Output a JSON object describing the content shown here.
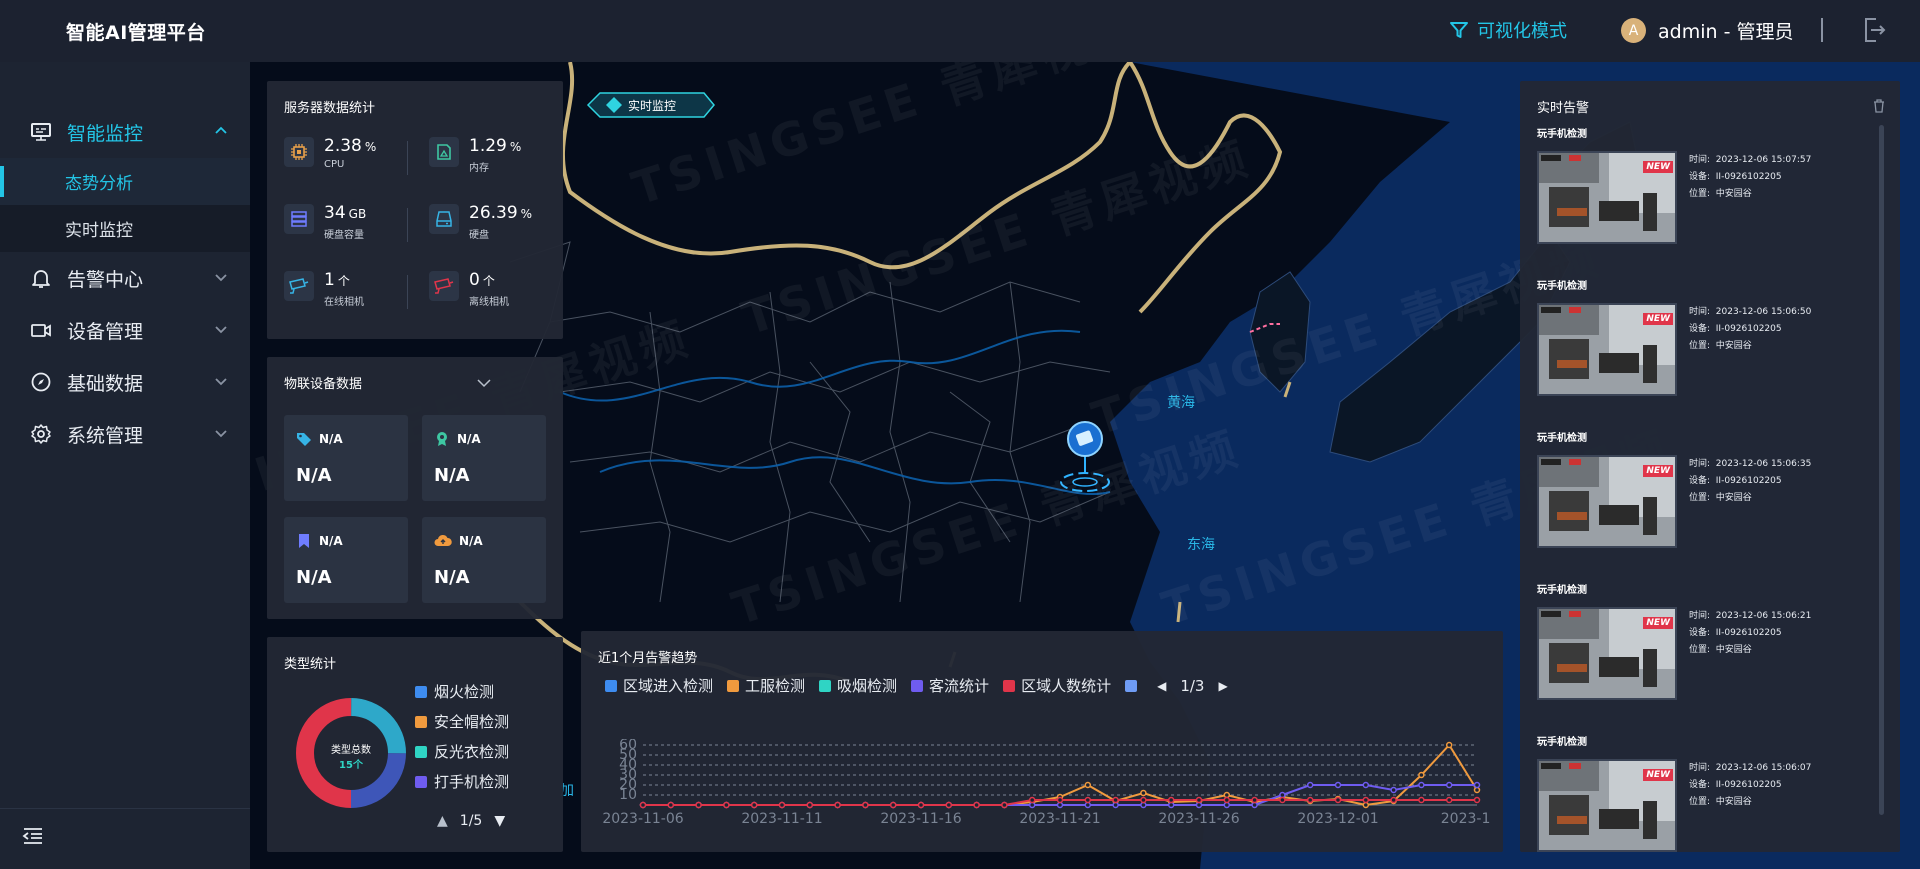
{
  "header": {
    "title": "智能AI管理平台",
    "mode_label": "可视化模式",
    "avatar_letter": "A",
    "user_label": "admin - 管理员"
  },
  "sidebar": {
    "items": [
      {
        "label": "智能监控",
        "icon": "monitor-icon",
        "expanded": true
      },
      {
        "label": "告警中心",
        "icon": "bell-icon"
      },
      {
        "label": "设备管理",
        "icon": "camera-device-icon"
      },
      {
        "label": "基础数据",
        "icon": "compass-icon"
      },
      {
        "label": "系统管理",
        "icon": "gear-icon"
      }
    ],
    "subitems": [
      {
        "label": "态势分析",
        "active": true
      },
      {
        "label": "实时监控"
      }
    ]
  },
  "map": {
    "live_tag": "实时监控",
    "sea_labels": [
      "黄海",
      "东海"
    ],
    "edge_text": "加",
    "watermark": [
      "TSINGSEE 青犀视频",
      "TSINGSEE 青犀视频",
      "TSINGSEE 青犀视频",
      "TSINGSEE 青犀视频",
      "TSINGSEE 青犀视频",
      "TSINGSEE 青犀视频"
    ]
  },
  "server_stats": {
    "title": "服务器数据统计",
    "items": [
      {
        "value": "2.38",
        "unit": "%",
        "label": "CPU",
        "icon": "cpu-icon",
        "color": "#e8a04a"
      },
      {
        "value": "1.29",
        "unit": "%",
        "label": "内存",
        "icon": "memory-icon",
        "color": "#3ec7a2"
      },
      {
        "value": "34",
        "unit": "GB",
        "label": "硬盘容量",
        "icon": "storage-icon",
        "color": "#6f7dff"
      },
      {
        "value": "26.39",
        "unit": "%",
        "label": "硬盘",
        "icon": "disk-icon",
        "color": "#36b4e6"
      },
      {
        "value": "1",
        "unit": "个",
        "label": "在线相机",
        "icon": "camera-online-icon",
        "color": "#36b4e6"
      },
      {
        "value": "0",
        "unit": "个",
        "label": "离线相机",
        "icon": "camera-offline-icon",
        "color": "#e0354a"
      }
    ]
  },
  "iot": {
    "title": "物联设备数据",
    "cards": [
      {
        "name": "N/A",
        "value": "N/A",
        "icon": "tag-icon",
        "color": "#36b4e6"
      },
      {
        "name": "N/A",
        "value": "N/A",
        "icon": "badge-icon",
        "color": "#3ec7a2"
      },
      {
        "name": "N/A",
        "value": "N/A",
        "icon": "bookmark-icon",
        "color": "#6f7dff"
      },
      {
        "name": "N/A",
        "value": "N/A",
        "icon": "cloud-icon",
        "color": "#f09a3e"
      }
    ]
  },
  "type_stats": {
    "title": "类型统计",
    "center_label": "类型总数",
    "center_value": "15个",
    "legend": [
      {
        "label": "烟火检测",
        "color": "#3e8cf0"
      },
      {
        "label": "安全帽检测",
        "color": "#f09a3e"
      },
      {
        "label": "反光衣检测",
        "color": "#2fd4c4"
      },
      {
        "label": "打手机检测",
        "color": "#6f5cf0"
      }
    ],
    "pager": "1/5",
    "donut": [
      {
        "color": "#e0354a",
        "value": 50
      },
      {
        "color": "#2ea8c9",
        "value": 25
      },
      {
        "color": "#3e56b8",
        "value": 25
      }
    ]
  },
  "trend": {
    "title": "近1个月告警趋势",
    "legend": [
      {
        "label": "区域进入检测",
        "color": "#3e8cf0"
      },
      {
        "label": "工服检测",
        "color": "#f09a3e"
      },
      {
        "label": "吸烟检测",
        "color": "#2fd4c4"
      },
      {
        "label": "客流统计",
        "color": "#6f5cf0"
      },
      {
        "label": "区域人数统计",
        "color": "#e0354a"
      },
      {
        "label": "",
        "color": "#6f9cf5"
      }
    ],
    "pager": "1/3"
  },
  "chart_data": {
    "type": "line",
    "x": [
      "2023-11-06",
      "2023-11-07",
      "2023-11-08",
      "2023-11-09",
      "2023-11-10",
      "2023-11-11",
      "2023-11-12",
      "2023-11-13",
      "2023-11-14",
      "2023-11-15",
      "2023-11-16",
      "2023-11-17",
      "2023-11-18",
      "2023-11-19",
      "2023-11-20",
      "2023-11-21",
      "2023-11-22",
      "2023-11-23",
      "2023-11-24",
      "2023-11-25",
      "2023-11-26",
      "2023-11-27",
      "2023-11-28",
      "2023-11-29",
      "2023-11-30",
      "2023-12-01",
      "2023-12-02",
      "2023-12-03",
      "2023-12-04",
      "2023-12-05",
      "2023-12-06"
    ],
    "x_tick_labels": [
      "2023-11-06",
      "2023-11-11",
      "2023-11-16",
      "2023-11-21",
      "2023-11-26",
      "2023-12-01",
      "2023-12-0"
    ],
    "ylim": [
      0,
      60
    ],
    "y_ticks": [
      10,
      20,
      30,
      40,
      50,
      60
    ],
    "series": [
      {
        "name": "工服检测",
        "color": "#f09a3e",
        "values": [
          0,
          0,
          0,
          0,
          0,
          0,
          0,
          0,
          0,
          0,
          0,
          0,
          0,
          0,
          3,
          8,
          20,
          4,
          12,
          3,
          4,
          10,
          3,
          8,
          4,
          6,
          0,
          4,
          30,
          60,
          15
        ]
      },
      {
        "name": "客流统计",
        "color": "#6f5cf0",
        "values": [
          0,
          0,
          0,
          0,
          0,
          0,
          0,
          0,
          0,
          0,
          0,
          0,
          0,
          0,
          0,
          0,
          0,
          0,
          0,
          0,
          0,
          0,
          0,
          10,
          20,
          20,
          20,
          15,
          20,
          20,
          20
        ]
      },
      {
        "name": "区域人数统计",
        "color": "#e0354a",
        "values": [
          0,
          0,
          0,
          0,
          0,
          0,
          0,
          0,
          0,
          0,
          0,
          0,
          0,
          0,
          5,
          5,
          5,
          5,
          5,
          5,
          5,
          5,
          5,
          5,
          5,
          5,
          5,
          5,
          5,
          5,
          5
        ]
      }
    ]
  },
  "alarms": {
    "title": "实时告警",
    "time_label": "时间:",
    "device_label": "设备:",
    "location_label": "位置:",
    "new_tag": "NEW",
    "items": [
      {
        "title": "玩手机检测",
        "time": "2023-12-06 15:07:57",
        "device": "II-0926102205",
        "location": "中安园谷"
      },
      {
        "title": "玩手机检测",
        "time": "2023-12-06 15:06:50",
        "device": "II-0926102205",
        "location": "中安园谷"
      },
      {
        "title": "玩手机检测",
        "time": "2023-12-06 15:06:35",
        "device": "II-0926102205",
        "location": "中安园谷"
      },
      {
        "title": "玩手机检测",
        "time": "2023-12-06 15:06:21",
        "device": "II-0926102205",
        "location": "中安园谷"
      },
      {
        "title": "玩手机检测",
        "time": "2023-12-06 15:06:07",
        "device": "II-0926102205",
        "location": "中安园谷"
      }
    ]
  }
}
